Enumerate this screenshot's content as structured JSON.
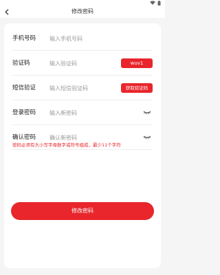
{
  "header": {
    "title": "修改密码",
    "back_icon": "chevron-left-icon"
  },
  "status_bar": {
    "icons": [
      "wifi-icon",
      "battery-icon"
    ]
  },
  "form": {
    "phone": {
      "label": "手机号码",
      "placeholder": "输入手机号码",
      "value": ""
    },
    "captcha": {
      "label": "验证码",
      "placeholder": "输入验证码",
      "value": "",
      "captcha_text": "wuv1"
    },
    "sms": {
      "label": "短信验证",
      "placeholder": "输入短信验证码",
      "value": "",
      "button_label": "获取验证码"
    },
    "password": {
      "label": "登录密码",
      "placeholder": "输入新密码",
      "value": "",
      "eye_icon": "eye-closed-icon"
    },
    "confirm": {
      "label": "确认密码",
      "placeholder": "确认新密码",
      "value": "",
      "eye_icon": "eye-closed-icon"
    },
    "hint": "密码必须有大小写字母数字或符号组成，最少11个字符",
    "submit_label": "修改密码"
  },
  "colors": {
    "accent": "#e8262b",
    "background": "#f5f5f5",
    "card": "#ffffff",
    "placeholder": "#999999"
  }
}
